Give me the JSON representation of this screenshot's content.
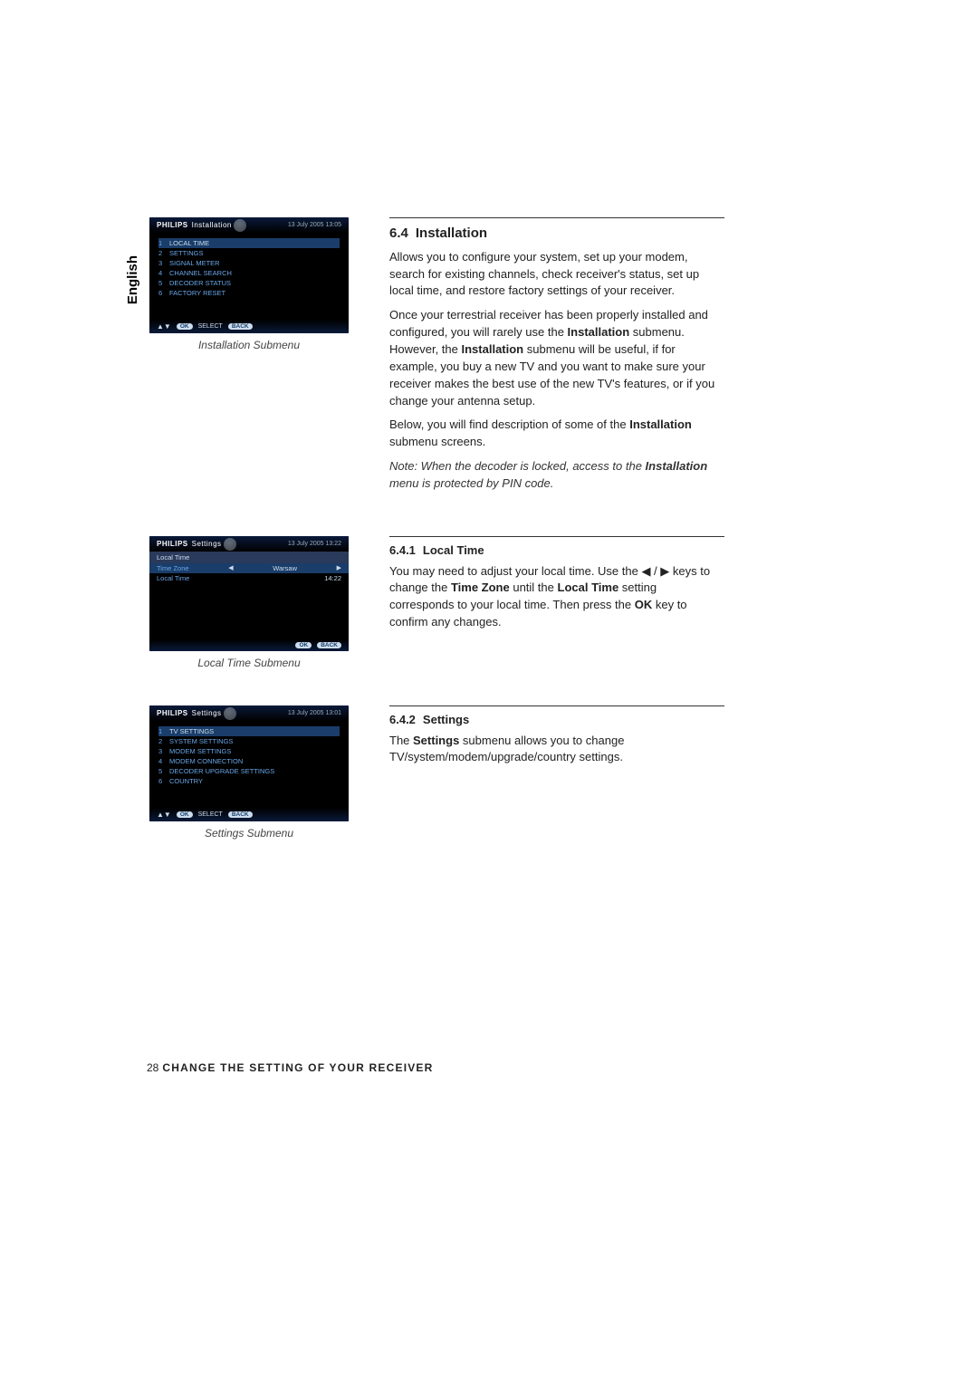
{
  "language_tab": "English",
  "screenshot1": {
    "brand": "PHILIPS",
    "title": "Installation",
    "datetime": "13 July 2005   13:05",
    "menu": [
      {
        "num": "1",
        "label": "LOCAL TIME"
      },
      {
        "num": "2",
        "label": "SETTINGS"
      },
      {
        "num": "3",
        "label": "SIGNAL METER"
      },
      {
        "num": "4",
        "label": "CHANNEL SEARCH"
      },
      {
        "num": "5",
        "label": "DECODER STATUS"
      },
      {
        "num": "6",
        "label": "FACTORY RESET"
      }
    ],
    "footer_ok": "OK",
    "footer_select": "SELECT",
    "footer_back": "BACK",
    "caption": "Installation Submenu"
  },
  "screenshot2": {
    "brand": "PHILIPS",
    "title": "Settings",
    "datetime": "13 July 2005   13:22",
    "subheader": "Local Time",
    "row1_label": "Time Zone",
    "row1_value": "Warsaw",
    "row2_label": "Local Time",
    "row2_value": "14:22",
    "footer_ok": "OK",
    "footer_back": "BACK",
    "caption": "Local Time  Submenu"
  },
  "screenshot3": {
    "brand": "PHILIPS",
    "title": "Settings",
    "datetime": "13 July 2005   13:01",
    "menu": [
      {
        "num": "1",
        "label": "TV SETTINGS"
      },
      {
        "num": "2",
        "label": "SYSTEM SETTINGS"
      },
      {
        "num": "3",
        "label": "MODEM SETTINGS"
      },
      {
        "num": "4",
        "label": "MODEM CONNECTION"
      },
      {
        "num": "5",
        "label": "DECODER UPGRADE SETTINGS"
      },
      {
        "num": "6",
        "label": "COUNTRY"
      }
    ],
    "footer_ok": "OK",
    "footer_select": "SELECT",
    "footer_back": "BACK",
    "caption": "Settings Submenu"
  },
  "section64": {
    "num": "6.4",
    "title": "Installation",
    "p1": "Allows you to configure your system, set up your modem, search for existing channels, check receiver's status, set up local time, and restore factory settings of your receiver.",
    "p2a": "Once your terrestrial receiver has been properly installed and configured, you will rarely use the ",
    "p2b_bold": "Installation",
    "p2c": " submenu.  However, the ",
    "p2d_bold": "Installation",
    "p2e": " submenu will be useful, if for example, you buy a new TV and you want to make sure your receiver makes the best use of the new TV's features, or if you change your antenna setup.",
    "p3a": "Below, you will find description of some of the ",
    "p3b_bold": "Installation",
    "p3c": " submenu screens.",
    "note_a": "Note: When the decoder is locked, access to the ",
    "note_b_bi": "Installation",
    "note_c": " menu is protected by PIN code."
  },
  "section641": {
    "num": "6.4.1",
    "title": "Local Time",
    "p1a": "You may need to adjust your local time. Use the  ◀ / ▶ keys to change the ",
    "p1b_bold": "Time Zone",
    "p1c": " until the ",
    "p1d_bold": "Local Time",
    "p1e": " setting corresponds to your local time. Then press the ",
    "p1f_bold": "OK",
    "p1g": " key to confirm any changes."
  },
  "section642": {
    "num": "6.4.2",
    "title": "Settings",
    "p1a": "The ",
    "p1b_bold": "Settings",
    "p1c": " submenu allows you to change TV/system/modem/upgrade/country  settings."
  },
  "footer": {
    "page_num": "28",
    "text": "CHANGE THE SETTING OF YOUR RECEIVER"
  }
}
